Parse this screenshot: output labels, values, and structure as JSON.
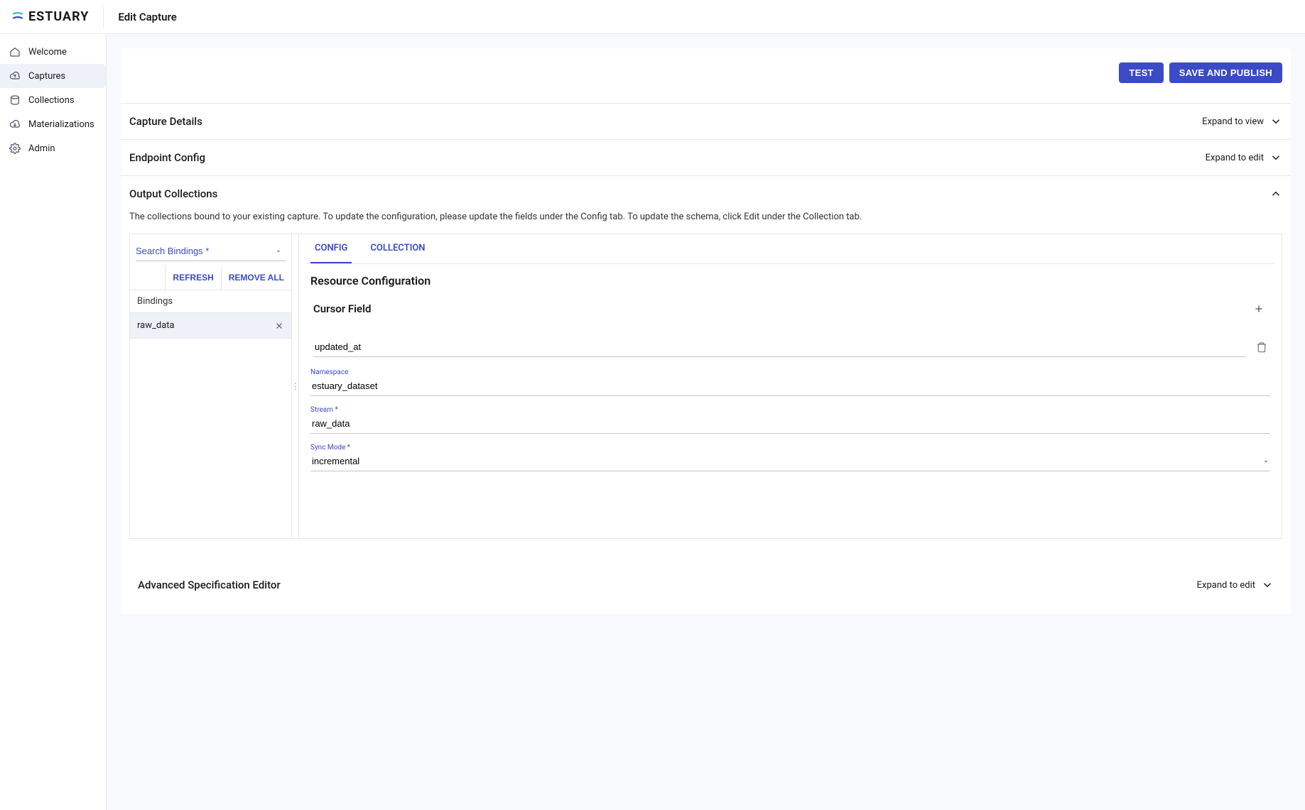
{
  "brand": "ESTUARY",
  "page_title": "Edit Capture",
  "sidebar": {
    "items": [
      {
        "label": "Welcome"
      },
      {
        "label": "Captures"
      },
      {
        "label": "Collections"
      },
      {
        "label": "Materializations"
      },
      {
        "label": "Admin"
      }
    ]
  },
  "actions": {
    "test": "TEST",
    "save": "SAVE AND PUBLISH"
  },
  "accordions": {
    "capture_details": {
      "title": "Capture Details",
      "action": "Expand to view"
    },
    "endpoint_config": {
      "title": "Endpoint Config",
      "action": "Expand to edit"
    },
    "output_collections": {
      "title": "Output Collections"
    },
    "advanced_editor": {
      "title": "Advanced Specification Editor",
      "action": "Expand to edit"
    }
  },
  "output": {
    "description": "The collections bound to your existing capture. To update the configuration, please update the fields under the Config tab. To update the schema, click Edit under the Collection tab.",
    "search_placeholder": "Search Bindings *",
    "refresh": "REFRESH",
    "remove_all": "REMOVE ALL",
    "bindings_header": "Bindings",
    "binding_item": "raw_data"
  },
  "config": {
    "tabs": {
      "config": "CONFIG",
      "collection": "COLLECTION"
    },
    "resource_title": "Resource Configuration",
    "cursor_title": "Cursor Field",
    "cursor_value": "updated_at",
    "namespace_label": "Namespace",
    "namespace_value": "estuary_dataset",
    "stream_label": "Stream *",
    "stream_value": "raw_data",
    "sync_label": "Sync Mode *",
    "sync_value": "incremental"
  }
}
